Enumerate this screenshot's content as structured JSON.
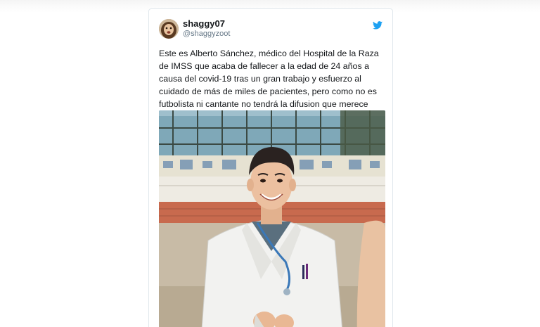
{
  "tweet": {
    "display_name": "shaggy07",
    "handle": "@shaggyzoot",
    "text": "Este es Alberto Sánchez, médico del Hospital de la Raza de IMSS que acaba de fallecer a la edad de 24 años a causa del covid-19 tras un gran trabajo y esfuerzo al cuidado de más de miles de pacientes, pero como no es futbolista ni cantante no tendrá la difusion que merece"
  },
  "colors": {
    "twitter_blue": "#1da1f2",
    "name_text": "#14171a",
    "handle_text": "#657786",
    "card_border": "#e1e8ed"
  },
  "icons": {
    "platform": "twitter-bird-icon"
  }
}
